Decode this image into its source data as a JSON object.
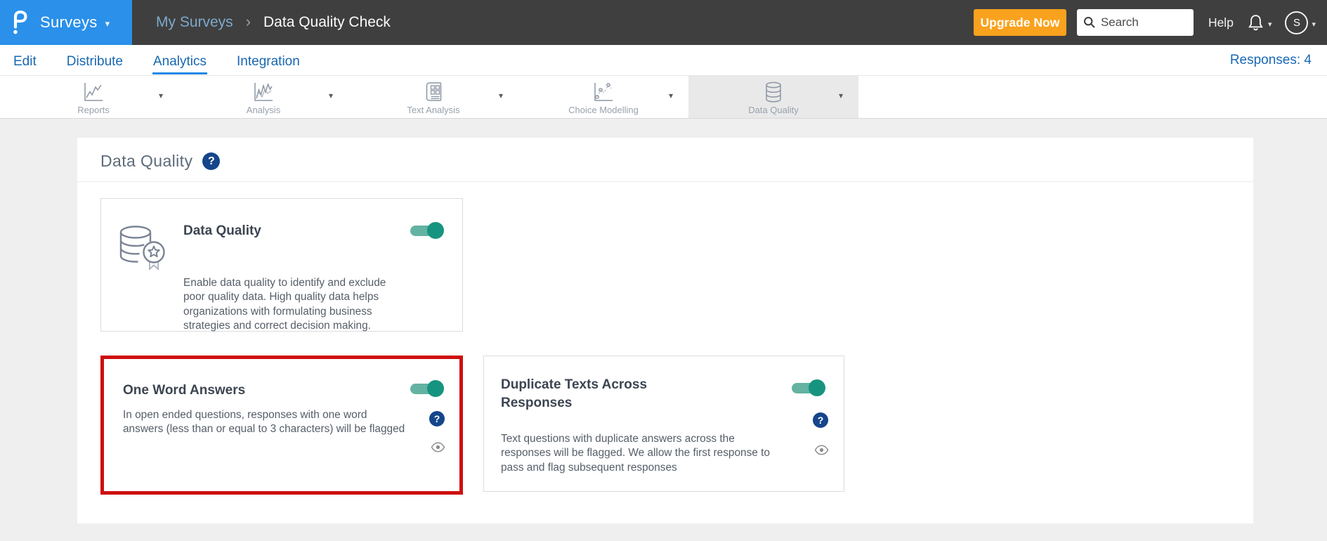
{
  "header": {
    "product": "Surveys",
    "breadcrumb": {
      "parent": "My Surveys",
      "current": "Data Quality Check"
    },
    "upgrade_label": "Upgrade Now",
    "search_placeholder": "Search",
    "help_label": "Help",
    "avatar_initial": "S"
  },
  "nav": {
    "items": [
      "Edit",
      "Distribute",
      "Analytics",
      "Integration"
    ],
    "active_item": "Analytics",
    "responses": "Responses: 4"
  },
  "toolbar": {
    "items": [
      {
        "label": "Reports"
      },
      {
        "label": "Analysis"
      },
      {
        "label": "Text Analysis"
      },
      {
        "label": "Choice Modelling"
      },
      {
        "label": "Data Quality"
      }
    ],
    "active_item": "Data Quality"
  },
  "content": {
    "heading": "Data Quality",
    "cards": [
      {
        "title": "Data Quality",
        "toggle": "on",
        "description": "Enable data quality to identify and exclude\npoor quality data. High quality data helps\norganizations with formulating business\nstrategies and correct decision making."
      },
      {
        "title": "One Word Answers",
        "toggle": "on",
        "highlighted": true,
        "description": "In open ended questions, responses with one word\nanswers (less than or equal to 3 characters) will be flagged"
      },
      {
        "title": "Duplicate Texts Across\nResponses",
        "toggle": "on",
        "description": "Text questions with duplicate answers across the\nresponses will be flagged. We allow the first response to\npass and flag subsequent responses"
      }
    ]
  },
  "icons": {
    "help_glyph": "?",
    "caret": "▾",
    "breadcrumb_separator": "›"
  },
  "colors": {
    "brand_blue": "#2a90ea",
    "header_gray": "#3f3f3f",
    "nav_blue": "#1767b1",
    "active_tab_underline": "#1e88e5",
    "upgrade_orange": "#f9a21d",
    "toggle_track": "#63b2a2",
    "toggle_knob": "#17947f",
    "highlight_red": "#ce0e0e",
    "help_badge_blue": "#15458a"
  }
}
